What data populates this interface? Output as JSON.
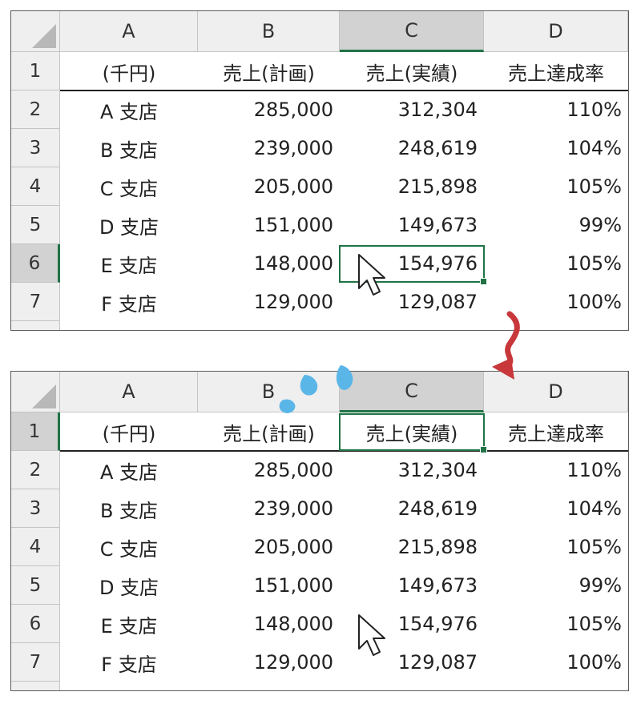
{
  "columns": [
    "A",
    "B",
    "C",
    "D"
  ],
  "header_row": [
    "(千円)",
    "売上(計画)",
    "売上(実績)",
    "売上達成率"
  ],
  "row_numbers": [
    "1",
    "2",
    "3",
    "4",
    "5",
    "6",
    "7"
  ],
  "rows": [
    [
      "A 支店",
      "285,000",
      "312,304",
      "110%"
    ],
    [
      "B 支店",
      "239,000",
      "248,619",
      "104%"
    ],
    [
      "C 支店",
      "205,000",
      "215,898",
      "105%"
    ],
    [
      "D 支店",
      "151,000",
      "149,673",
      "99%"
    ],
    [
      "E 支店",
      "148,000",
      "154,976",
      "105%"
    ],
    [
      "F 支店",
      "129,000",
      "129,087",
      "100%"
    ]
  ],
  "colors": {
    "selection": "#217346",
    "arrow": "#c8373a",
    "drops": "#5bb6e8",
    "header_bg": "#efefef",
    "header_selected_bg": "#d2d2d2"
  },
  "icons": {
    "cursor": "mouse-pointer-arrow-icon",
    "transition": "down-curved-arrow-icon",
    "effect": "water-drops-icon"
  }
}
